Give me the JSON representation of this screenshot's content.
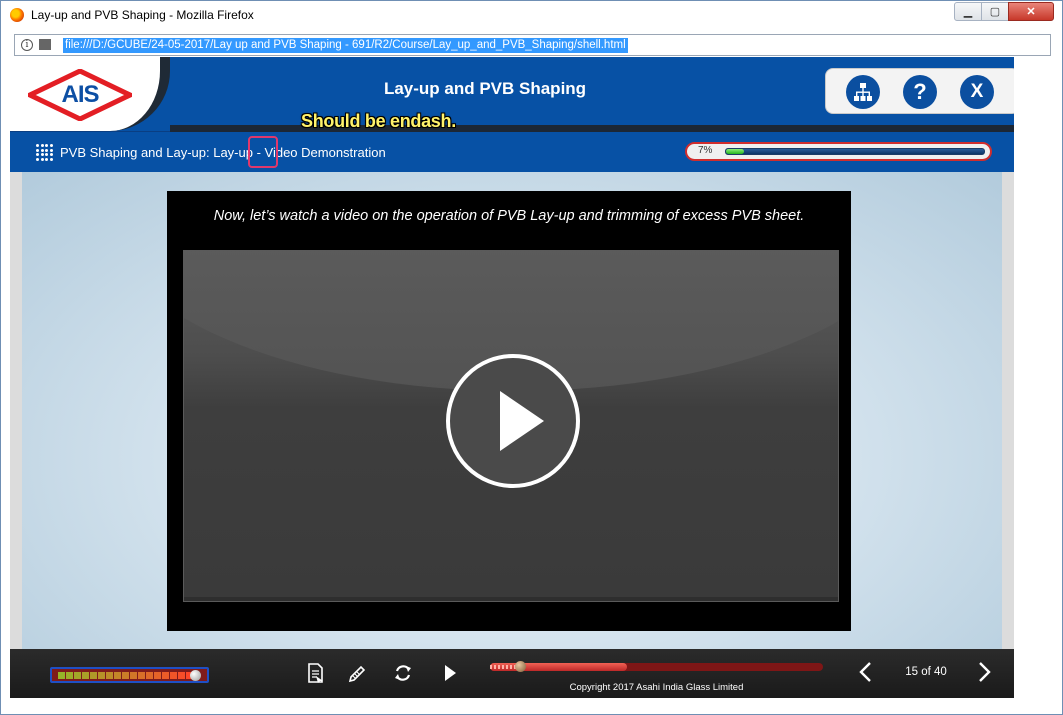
{
  "browser": {
    "window_title": "Lay-up and PVB Shaping - Mozilla Firefox",
    "url": "file:///D:/GCUBE/24-05-2017/Lay up and PVB Shaping - 691/R2/Course/Lay_up_and_PVB_Shaping/shell.html",
    "min_label": "▁",
    "max_label": "▢",
    "close_label": "✕",
    "info_label": "i"
  },
  "header": {
    "logo_text": "AIS",
    "course_title": "Lay-up and PVB Shaping",
    "sitemap_label": "sitemap",
    "help_label": "?",
    "exit_label": "X"
  },
  "annotation": {
    "text": "Should be endash."
  },
  "subbar": {
    "breadcrumb": "PVB Shaping and Lay-up: Lay-up - Video Demonstration",
    "progress_text": "7%",
    "progress_fraction": 0.07
  },
  "video": {
    "caption": "Now, let’s watch a video on the operation of PVB Lay-up and trimming of excess PVB sheet."
  },
  "footer": {
    "copyright": "Copyright 2017 Asahi India Glass Limited",
    "page_count": "15 of 40",
    "seek_fraction": 0.08,
    "volume_cells": 17
  },
  "colors": {
    "brand_blue": "#0751a5",
    "highlight": "#e0386b",
    "annotation_yellow": "#fff36b",
    "progress_green": "#24b51e"
  }
}
